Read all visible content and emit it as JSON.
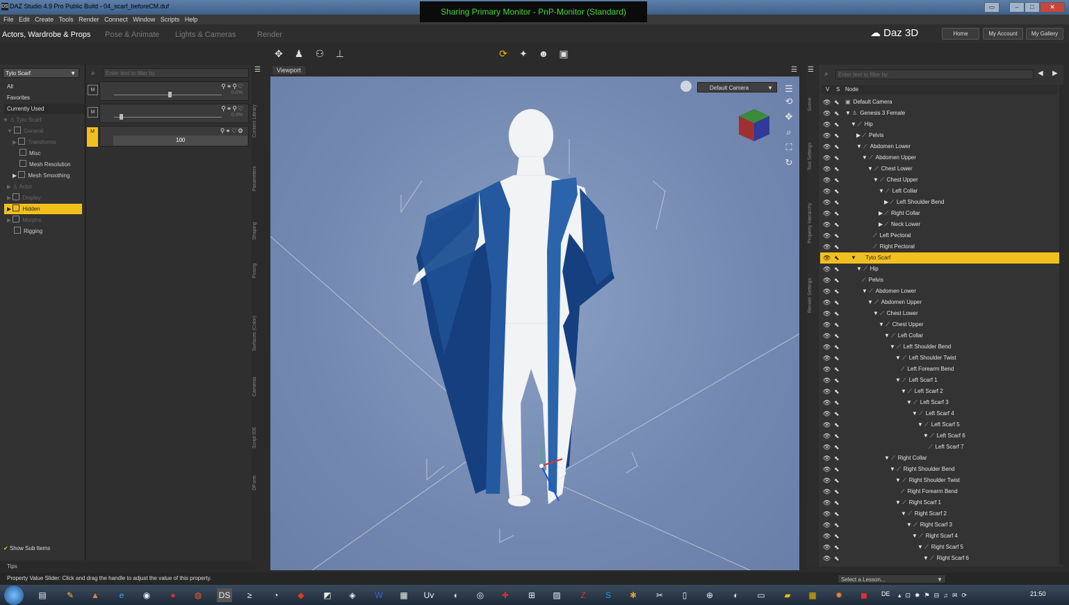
{
  "window": {
    "title": "DAZ Studio 4.9 Pro Public Build - 04_scarf_beforeCM.duf",
    "app_icon": "DS"
  },
  "share_banner": "Sharing Primary Monitor - PnP-Monitor (Standard)",
  "menu": [
    "File",
    "Edit",
    "Create",
    "Tools",
    "Render",
    "Connect",
    "Window",
    "Scripts",
    "Help"
  ],
  "rooms": {
    "tab1": "Actors, Wardrobe & Props",
    "tab2": "Pose & Animate",
    "tab3": "Lights & Cameras",
    "tab4": "Render"
  },
  "brand": {
    "logo": "Daz 3D",
    "home": "Home",
    "account": "My Account",
    "gallery": "My Gallery"
  },
  "left": {
    "node_select": "Tyto Scarf",
    "categories": [
      "All",
      "Favorites",
      "Currently Used"
    ],
    "tree": [
      "Tyto Scarf",
      "General",
      "Transforms",
      "Misc",
      "Mesh Resolution",
      "Mesh Smoothing",
      "Actor",
      "Display",
      "Hidden",
      "Morphs",
      "Rigging"
    ],
    "show_sub": "Show Sub Items"
  },
  "params": {
    "filter_placeholder": "Enter text to filter by",
    "slider1_value": "0.0%",
    "slider2_value": "0.0%",
    "value_field": "100",
    "side_tabs": [
      "Content Library",
      "Parameters",
      "Shaping",
      "Posing",
      "Surfaces (Color)",
      "Cameras",
      "Script IDE",
      "DForm"
    ]
  },
  "viewport": {
    "label": "Viewport",
    "camera": "Default Camera"
  },
  "scene": {
    "filter_placeholder": "Enter text to filter by",
    "col_v": "V",
    "col_s": "S",
    "col_node": "Node",
    "side_tabs": [
      "Scene",
      "Tool Settings",
      "Property Hierarchy",
      "Render Settings"
    ],
    "rows": [
      {
        "label": "Default Camera",
        "indent": 0,
        "arrow": "",
        "kind": "camera"
      },
      {
        "label": "Genesis 3 Female",
        "indent": 0,
        "arrow": "▼",
        "kind": "figure"
      },
      {
        "label": "Hip",
        "indent": 1,
        "arrow": "▼",
        "kind": "bone"
      },
      {
        "label": "Pelvis",
        "indent": 2,
        "arrow": "▶",
        "kind": "bone"
      },
      {
        "label": "Abdomen Lower",
        "indent": 2,
        "arrow": "▼",
        "kind": "bone"
      },
      {
        "label": "Abdomen Upper",
        "indent": 3,
        "arrow": "▼",
        "kind": "bone"
      },
      {
        "label": "Chest Lower",
        "indent": 4,
        "arrow": "▼",
        "kind": "bone"
      },
      {
        "label": "Chest Upper",
        "indent": 5,
        "arrow": "▼",
        "kind": "bone"
      },
      {
        "label": "Left Collar",
        "indent": 6,
        "arrow": "▼",
        "kind": "bone"
      },
      {
        "label": "Left Shoulder Bend",
        "indent": 7,
        "arrow": "▶",
        "kind": "bone"
      },
      {
        "label": "Right Collar",
        "indent": 6,
        "arrow": "▶",
        "kind": "bone"
      },
      {
        "label": "Neck Lower",
        "indent": 6,
        "arrow": "▶",
        "kind": "bone"
      },
      {
        "label": "Left Pectoral",
        "indent": 5,
        "arrow": "",
        "kind": "bone"
      },
      {
        "label": "Right Pectoral",
        "indent": 5,
        "arrow": "",
        "kind": "bone"
      },
      {
        "label": "Tyto Scarf",
        "indent": 1,
        "arrow": "▼",
        "kind": "figure",
        "selected": true
      },
      {
        "label": "Hip",
        "indent": 2,
        "arrow": "▼",
        "kind": "bone"
      },
      {
        "label": "Pelvis",
        "indent": 3,
        "arrow": "",
        "kind": "bone"
      },
      {
        "label": "Abdomen Lower",
        "indent": 3,
        "arrow": "▼",
        "kind": "bone"
      },
      {
        "label": "Abdomen Upper",
        "indent": 4,
        "arrow": "▼",
        "kind": "bone"
      },
      {
        "label": "Chest Lower",
        "indent": 5,
        "arrow": "▼",
        "kind": "bone"
      },
      {
        "label": "Chest Upper",
        "indent": 6,
        "arrow": "▼",
        "kind": "bone"
      },
      {
        "label": "Left Collar",
        "indent": 7,
        "arrow": "▼",
        "kind": "bone"
      },
      {
        "label": "Left Shoulder Bend",
        "indent": 8,
        "arrow": "▼",
        "kind": "bone"
      },
      {
        "label": "Left Shoulder Twist",
        "indent": 9,
        "arrow": "▼",
        "kind": "bone"
      },
      {
        "label": "Left Forearm Bend",
        "indent": 10,
        "arrow": "",
        "kind": "bone"
      },
      {
        "label": "Left Scarf 1",
        "indent": 9,
        "arrow": "▼",
        "kind": "bone"
      },
      {
        "label": "Left Scarf 2",
        "indent": 10,
        "arrow": "▼",
        "kind": "bone"
      },
      {
        "label": "Left Scarf 3",
        "indent": 11,
        "arrow": "▼",
        "kind": "bone"
      },
      {
        "label": "Left Scarf 4",
        "indent": 12,
        "arrow": "▼",
        "kind": "bone"
      },
      {
        "label": "Left Scarf 5",
        "indent": 13,
        "arrow": "▼",
        "kind": "bone"
      },
      {
        "label": "Left Scarf 6",
        "indent": 14,
        "arrow": "▼",
        "kind": "bone"
      },
      {
        "label": "Left Scarf 7",
        "indent": 15,
        "arrow": "",
        "kind": "bone"
      },
      {
        "label": "Right Collar",
        "indent": 7,
        "arrow": "▼",
        "kind": "bone"
      },
      {
        "label": "Right Shoulder Bend",
        "indent": 8,
        "arrow": "▼",
        "kind": "bone"
      },
      {
        "label": "Right Shoulder Twist",
        "indent": 9,
        "arrow": "▼",
        "kind": "bone"
      },
      {
        "label": "Right Forearm Bend",
        "indent": 10,
        "arrow": "",
        "kind": "bone"
      },
      {
        "label": "Right Scarf 1",
        "indent": 9,
        "arrow": "▼",
        "kind": "bone"
      },
      {
        "label": "Right Scarf 2",
        "indent": 10,
        "arrow": "▼",
        "kind": "bone"
      },
      {
        "label": "Right Scarf 3",
        "indent": 11,
        "arrow": "▼",
        "kind": "bone"
      },
      {
        "label": "Right Scarf 4",
        "indent": 12,
        "arrow": "▼",
        "kind": "bone"
      },
      {
        "label": "Right Scarf 5",
        "indent": 13,
        "arrow": "▼",
        "kind": "bone"
      },
      {
        "label": "Right Scarf 6",
        "indent": 14,
        "arrow": "▼",
        "kind": "bone"
      }
    ]
  },
  "status": {
    "tips": "Tips",
    "message": "Property Value Slider: Click and drag the handle to adjust the value of this property.",
    "lesson": "Select a Lesson..."
  },
  "taskbar": {
    "lang": "DE",
    "clock": "21:50"
  },
  "colors": {
    "highlight": "#f2c01d",
    "scarf": "#1f4f95",
    "viewport_bg": "#7a8fb6"
  }
}
